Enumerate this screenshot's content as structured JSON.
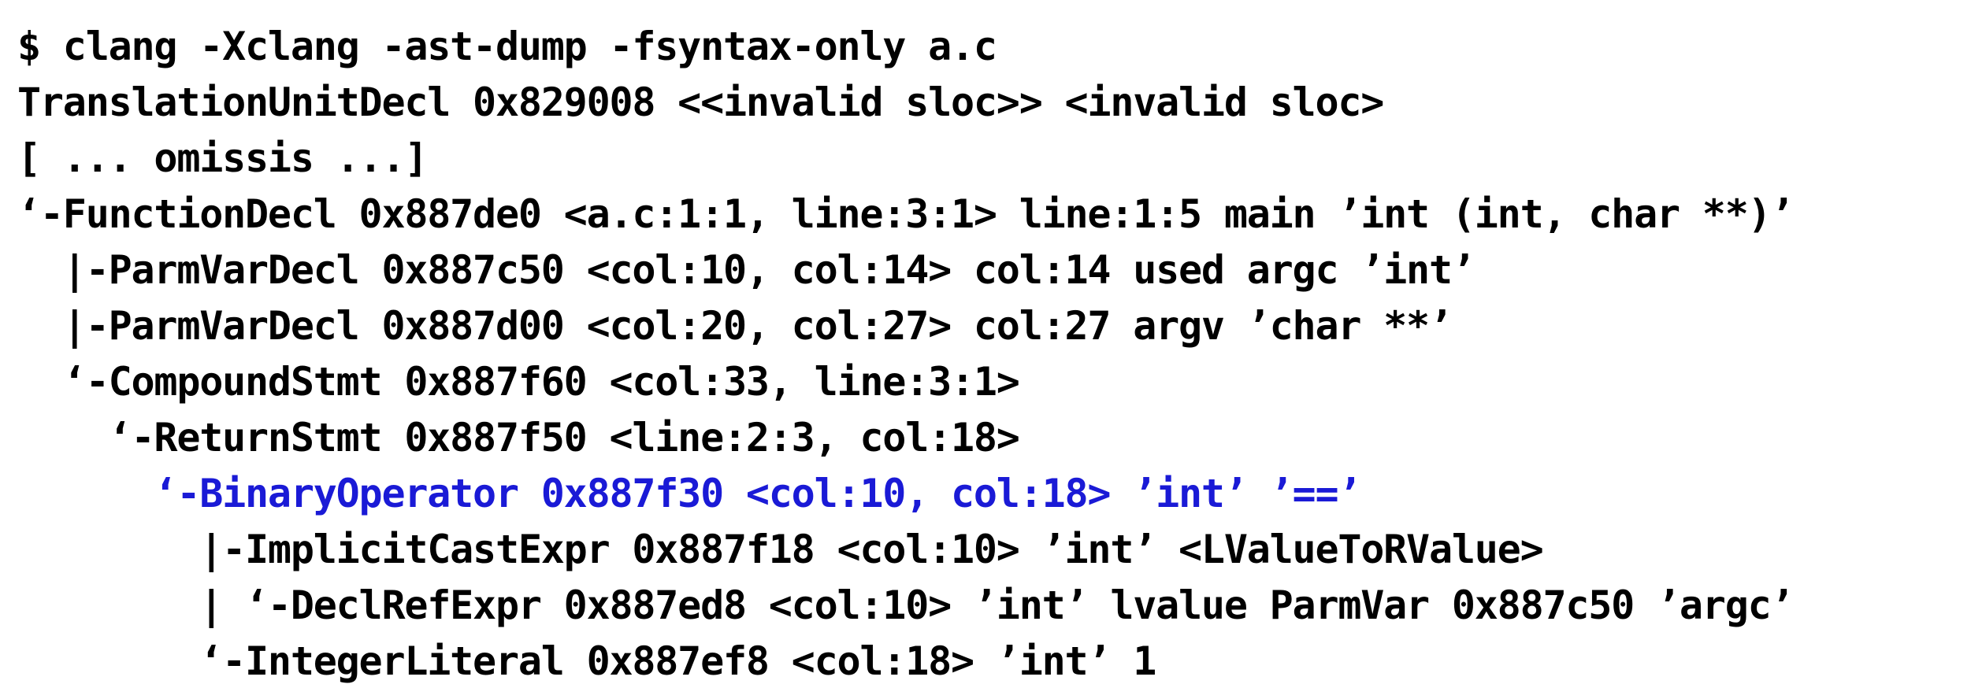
{
  "terminal": {
    "lines": [
      {
        "text": "$ clang -Xclang -ast-dump -fsyntax-only a.c",
        "highlight": false
      },
      {
        "text": "TranslationUnitDecl 0x829008 <<invalid sloc>> <invalid sloc>",
        "highlight": false
      },
      {
        "text": "[ ... omissis ...]",
        "highlight": false
      },
      {
        "text": "‘-FunctionDecl 0x887de0 <a.c:1:1, line:3:1> line:1:5 main ’int (int, char **)’",
        "highlight": false
      },
      {
        "text": "  |-ParmVarDecl 0x887c50 <col:10, col:14> col:14 used argc ’int’",
        "highlight": false
      },
      {
        "text": "  |-ParmVarDecl 0x887d00 <col:20, col:27> col:27 argv ’char **’",
        "highlight": false
      },
      {
        "text": "  ‘-CompoundStmt 0x887f60 <col:33, line:3:1>",
        "highlight": false
      },
      {
        "text": "    ‘-ReturnStmt 0x887f50 <line:2:3, col:18>",
        "highlight": false
      },
      {
        "text": "      ‘-BinaryOperator 0x887f30 <col:10, col:18> ’int’ ’==’",
        "highlight": true
      },
      {
        "text": "        |-ImplicitCastExpr 0x887f18 <col:10> ’int’ <LValueToRValue>",
        "highlight": false
      },
      {
        "text": "        | ‘-DeclRefExpr 0x887ed8 <col:10> ’int’ lvalue ParmVar 0x887c50 ’argc’",
        "highlight": false
      },
      {
        "text": "        ‘-IntegerLiteral 0x887ef8 <col:18> ’int’ 1",
        "highlight": false
      }
    ],
    "colors": {
      "text": "#000000",
      "highlight": "#1a1ad6",
      "background": "#ffffff"
    }
  }
}
